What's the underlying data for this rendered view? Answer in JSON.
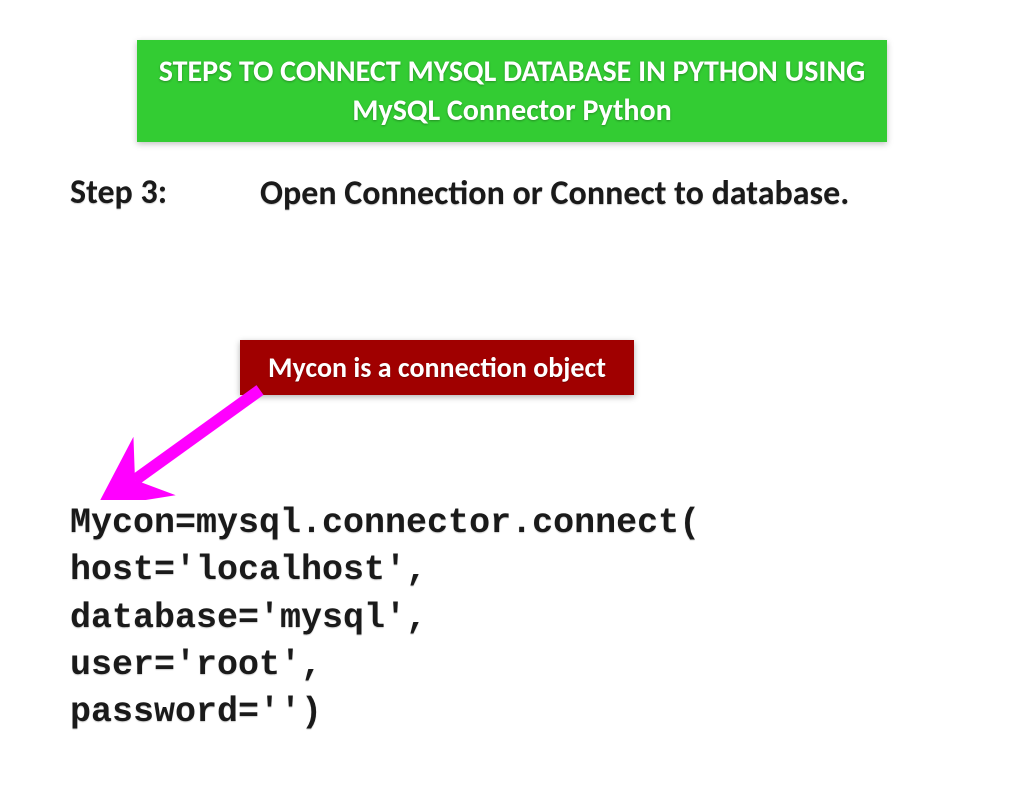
{
  "title": "STEPS TO CONNECT MYSQL DATABASE IN PYTHON USING MySQL Connector Python",
  "step": {
    "label": "Step  3:",
    "description": "Open Connection or Connect to database."
  },
  "callout": "Mycon is a connection object",
  "code": {
    "line1": "Mycon=mysql.connector.connect(",
    "line2": "host='localhost',",
    "line3": "database='mysql',",
    "line4": "user='root',",
    "line5": "password='')"
  }
}
